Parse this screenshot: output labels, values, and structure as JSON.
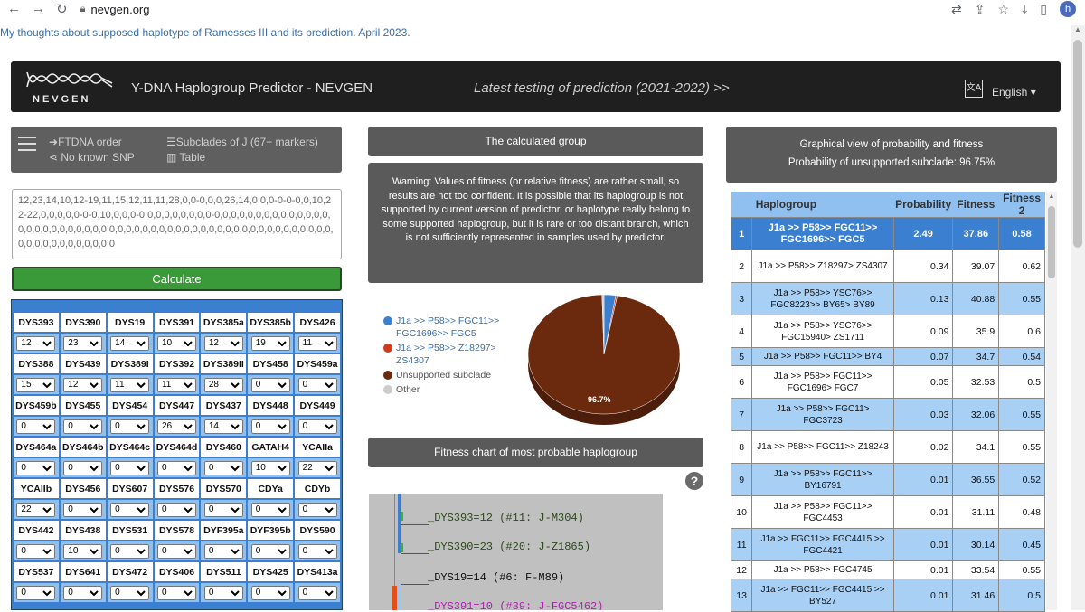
{
  "browser": {
    "url": "nevgen.org",
    "avatar_letter": "h"
  },
  "top_link": "My thoughts about supposed haplotype of Ramesses III and its prediction. April 2023.",
  "header": {
    "logo_text": "NEVGEN",
    "title": "Y-DNA Haplogroup Predictor - NEVGEN",
    "latest_link": "Latest testing of prediction (2021-2022) >>",
    "language": "English ▾"
  },
  "toolbar": {
    "ftdna_order": "FTDNA order",
    "subclades": "Subclades of J (67+ markers)",
    "no_snp": "No known SNP",
    "table": "Table"
  },
  "haplotype_input": "12,23,14,10,12-19,11,15,12,11,11,28,0,0-0,0,0,26,14,0,0,0-0-0-0,0,10,22-22,0,0,0,0,0-0-0,10,0,0,0-0,0,0,0,0,0,0,0,0-0,0,0,0,0,0,0,0,0,0,0,0,0,0,0,0,0,0,0,0,0,0,0,0,0,0,0,0,0,0,0,0,0,0,0,0,0,0,0,0,0,0,0,0,0,0,0,0,0,0,0,0,0,0,0,0,0,0,0,0,0,0,0,0",
  "calculate_label": "Calculate",
  "marker_rows": [
    {
      "labels": [
        "DYS393",
        "DYS390",
        "DYS19",
        "DYS391",
        "DYS385a",
        "DYS385b",
        "DYS426"
      ],
      "values": [
        "12",
        "23",
        "14",
        "10",
        "12",
        "19",
        "11"
      ]
    },
    {
      "labels": [
        "DYS388",
        "DYS439",
        "DYS389I",
        "DYS392",
        "DYS389II",
        "DYS458",
        "DYS459a"
      ],
      "values": [
        "15",
        "12",
        "11",
        "11",
        "28",
        "0",
        "0"
      ]
    },
    {
      "labels": [
        "DYS459b",
        "DYS455",
        "DYS454",
        "DYS447",
        "DYS437",
        "DYS448",
        "DYS449"
      ],
      "values": [
        "0",
        "0",
        "0",
        "26",
        "14",
        "0",
        "0"
      ]
    },
    {
      "labels": [
        "DYS464a",
        "DYS464b",
        "DYS464c",
        "DYS464d",
        "DYS460",
        "GATAH4",
        "YCAIIa"
      ],
      "values": [
        "0",
        "0",
        "0",
        "0",
        "0",
        "10",
        "22"
      ]
    },
    {
      "labels": [
        "YCAIIb",
        "DYS456",
        "DYS607",
        "DYS576",
        "DYS570",
        "CDYa",
        "CDYb"
      ],
      "values": [
        "22",
        "0",
        "0",
        "0",
        "0",
        "0",
        "0"
      ]
    },
    {
      "labels": [
        "DYS442",
        "DYS438",
        "DYS531",
        "DYS578",
        "DYF395a",
        "DYF395b",
        "DYS590"
      ],
      "values": [
        "0",
        "10",
        "0",
        "0",
        "0",
        "0",
        "0"
      ]
    },
    {
      "labels": [
        "DYS537",
        "DYS641",
        "DYS472",
        "DYS406",
        "DYS511",
        "DYS425",
        "DYS413a"
      ],
      "values": [
        "0",
        "0",
        "0",
        "0",
        "0",
        "0",
        "0"
      ]
    }
  ],
  "calculated_group_title": "The calculated group",
  "warning_text": "Warning: Values of fitness (or relative fitness) are rather small, so results are not too confident. It is possible that its haplogroup is not supported by current version of predictor, or haplotype really belong to some supported haplogroup, but it is rare or too distant branch, which is not sufficiently represented in samples used by predictor.",
  "legend": [
    {
      "label": "J1a >> P58>> FGC11>> FGC1696>> FGC5",
      "color": "#3a7fd0"
    },
    {
      "label": "J1a >> P58>> Z18297> ZS4307",
      "color": "#d03a1a"
    },
    {
      "label": "Unsupported subclade",
      "color": "#6b2a0e"
    },
    {
      "label": "Other",
      "color": "#cccccc"
    }
  ],
  "pie": {
    "label": "96.7%",
    "slices": [
      {
        "name": "J1a >> P58>> FGC11>> FGC1696>> FGC5",
        "value": 2.49,
        "color": "#3a7fd0"
      },
      {
        "name": "J1a >> P58>> Z18297> ZS4307",
        "value": 0.34,
        "color": "#d03a1a"
      },
      {
        "name": "Unsupported subclade",
        "value": 96.75,
        "color": "#6b2a0e"
      },
      {
        "name": "Other",
        "value": 0.42,
        "color": "#cccccc"
      }
    ]
  },
  "fitness_chart_title": "Fitness chart of most probable haplogroup",
  "help_label": "?",
  "fitness_lines": [
    {
      "text": "DYS393=12 (#11: J-M304)",
      "style": "normal"
    },
    {
      "text": "DYS390=23 (#20: J-Z1865)",
      "style": "normal"
    },
    {
      "text": "DYS19=14 (#6: F-M89)",
      "style": "black"
    },
    {
      "text": "DYS391=10 (#39: J-FGC5462)",
      "style": "magenta"
    }
  ],
  "graphical_view": {
    "title": "Graphical view of probability and fitness",
    "unsupported": "Probability of unsupported subclade: 96.75%"
  },
  "table": {
    "headers": [
      "Haplogroup",
      "Probability",
      "Fitness",
      "Fitness 2"
    ],
    "rows": [
      {
        "idx": "1",
        "hap": "J1a >> P58>> FGC11>> FGC1696>> FGC5",
        "prob": "2.49",
        "fit": "37.86",
        "fit2": "0.58"
      },
      {
        "idx": "2",
        "hap": "J1a >> P58>> Z18297> ZS4307",
        "prob": "0.34",
        "fit": "39.07",
        "fit2": "0.62"
      },
      {
        "idx": "3",
        "hap": "J1a >> P58>> YSC76>> FGC8223>> BY65> BY89",
        "prob": "0.13",
        "fit": "40.88",
        "fit2": "0.55"
      },
      {
        "idx": "4",
        "hap": "J1a >> P58>> YSC76>> FGC15940> ZS1711",
        "prob": "0.09",
        "fit": "35.9",
        "fit2": "0.6"
      },
      {
        "idx": "5",
        "hap": "J1a >> P58>> FGC11>> BY4",
        "prob": "0.07",
        "fit": "34.7",
        "fit2": "0.54"
      },
      {
        "idx": "6",
        "hap": "J1a >> P58>> FGC11>> FGC1696> FGC7",
        "prob": "0.05",
        "fit": "32.53",
        "fit2": "0.5"
      },
      {
        "idx": "7",
        "hap": "J1a >> P58>> FGC11> FGC3723",
        "prob": "0.03",
        "fit": "32.06",
        "fit2": "0.55"
      },
      {
        "idx": "8",
        "hap": "J1a >> P58>> FGC11>> Z18243",
        "prob": "0.02",
        "fit": "34.1",
        "fit2": "0.55"
      },
      {
        "idx": "9",
        "hap": "J1a >> P58>> FGC11>> BY16791",
        "prob": "0.01",
        "fit": "36.55",
        "fit2": "0.52"
      },
      {
        "idx": "10",
        "hap": "J1a >> P58>> FGC11>> FGC4453",
        "prob": "0.01",
        "fit": "31.11",
        "fit2": "0.48"
      },
      {
        "idx": "11",
        "hap": "J1a >> FGC11>> FGC4415 >> FGC4421",
        "prob": "0.01",
        "fit": "30.14",
        "fit2": "0.45"
      },
      {
        "idx": "12",
        "hap": "J1a >> P58>> FGC4745",
        "prob": "0.01",
        "fit": "33.54",
        "fit2": "0.55"
      },
      {
        "idx": "13",
        "hap": "J1a >> FGC11>> FGC4415 >> BY527",
        "prob": "0.01",
        "fit": "31.46",
        "fit2": "0.5"
      }
    ]
  }
}
